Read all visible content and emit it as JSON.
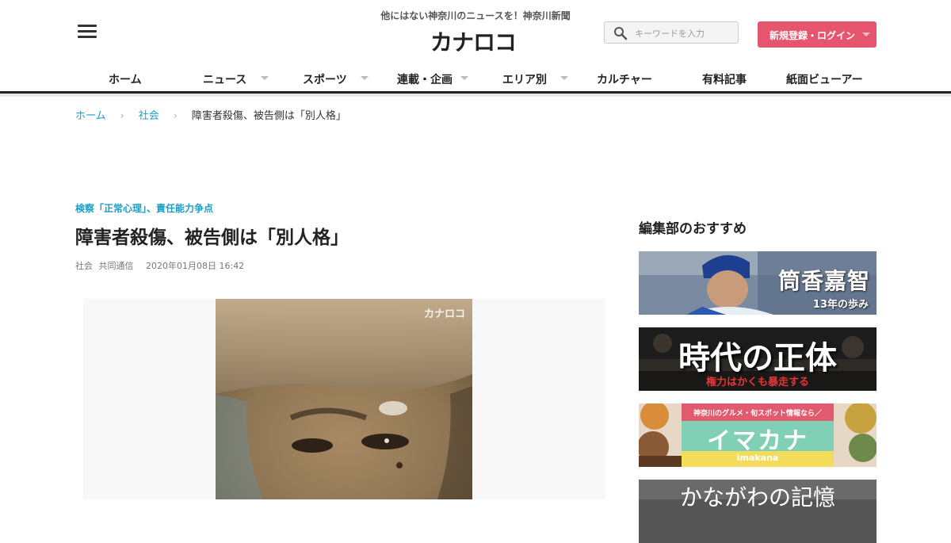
{
  "header": {
    "tagline": "他にはない神奈川のニュースを！神奈川新聞",
    "logo": "カナロコ",
    "search_placeholder": "キーワードを入力",
    "login_label": "新規登録・ログイン"
  },
  "nav": {
    "items": [
      {
        "label": "ホーム",
        "has_dropdown": false
      },
      {
        "label": "ニュース",
        "has_dropdown": true
      },
      {
        "label": "スポーツ",
        "has_dropdown": true
      },
      {
        "label": "連載・企画",
        "has_dropdown": true
      },
      {
        "label": "エリア別",
        "has_dropdown": true
      },
      {
        "label": "カルチャー",
        "has_dropdown": false
      },
      {
        "label": "有料記事",
        "has_dropdown": false
      },
      {
        "label": "紙面ビューアー",
        "has_dropdown": false
      }
    ]
  },
  "breadcrumb": {
    "home": "ホーム",
    "category": "社会",
    "current": "障害者殺傷、被告側は「別人格」"
  },
  "article": {
    "kicker": "検察「正常心理」、責任能力争点",
    "title": "障害者殺傷、被告側は「別人格」",
    "category": "社会",
    "source": "共同通信",
    "date": "2020年01月08日 16:42",
    "photo_watermark": "カナロコ"
  },
  "sidebar": {
    "heading": "編集部のおすすめ",
    "banners": [
      {
        "title": "筒香嘉智",
        "subtitle": "13年の歩み"
      },
      {
        "title": "時代の正体",
        "subtitle": "権力はかくも暴走する"
      },
      {
        "title": "イマカナ",
        "subtitle": "神奈川のグルメ・旬スポット情報なら／",
        "romaji": "imakana"
      },
      {
        "title": "かながわの記憶"
      }
    ]
  },
  "colors": {
    "accent_blue": "#1a9fc9",
    "login_red": "#e5556d",
    "imakana_green": "#7fd0b4",
    "imakana_yellow": "#f3dc5c"
  }
}
